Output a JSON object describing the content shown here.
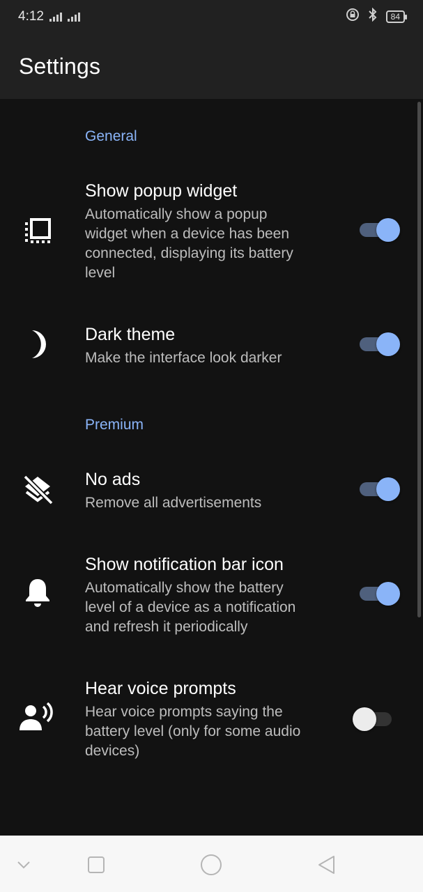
{
  "status_bar": {
    "time": "4:12",
    "battery": "84",
    "icons": [
      "signal-icon",
      "signal-icon",
      "vpn-lock-icon",
      "bluetooth-icon",
      "battery-icon"
    ]
  },
  "app_bar": {
    "title": "Settings"
  },
  "sections": {
    "general": "General",
    "premium": "Premium"
  },
  "settings": {
    "popup_widget": {
      "title": "Show popup widget",
      "description": [
        "Automatically show a popup",
        "widget when a device has been",
        "connected, displaying its battery",
        "level"
      ],
      "icon": "popup-widget-icon",
      "enabled": true
    },
    "dark_theme": {
      "title": "Dark theme",
      "description": [
        "Make the interface look darker"
      ],
      "icon": "moon-icon",
      "enabled": true
    },
    "no_ads": {
      "title": "No ads",
      "description": [
        "Remove all advertisements"
      ],
      "icon": "layers-off-icon",
      "enabled": true
    },
    "notification_icon": {
      "title": "Show notification bar icon",
      "description": [
        "Automatically show the battery",
        "level of a device as a notification",
        "and refresh it periodically"
      ],
      "icon": "bell-icon",
      "enabled": true
    },
    "voice_prompts": {
      "title": "Hear voice prompts",
      "description": [
        "Hear voice prompts saying the",
        "battery level (only for some audio",
        "devices)"
      ],
      "icon": "voice-person-icon",
      "enabled": false
    }
  },
  "colors": {
    "accent": "#8ab4f8",
    "background": "#121212",
    "app_bar": "#212121"
  },
  "nav_bar": {
    "icons": [
      "chevron-down-icon",
      "recents-icon",
      "home-icon",
      "back-icon"
    ]
  }
}
